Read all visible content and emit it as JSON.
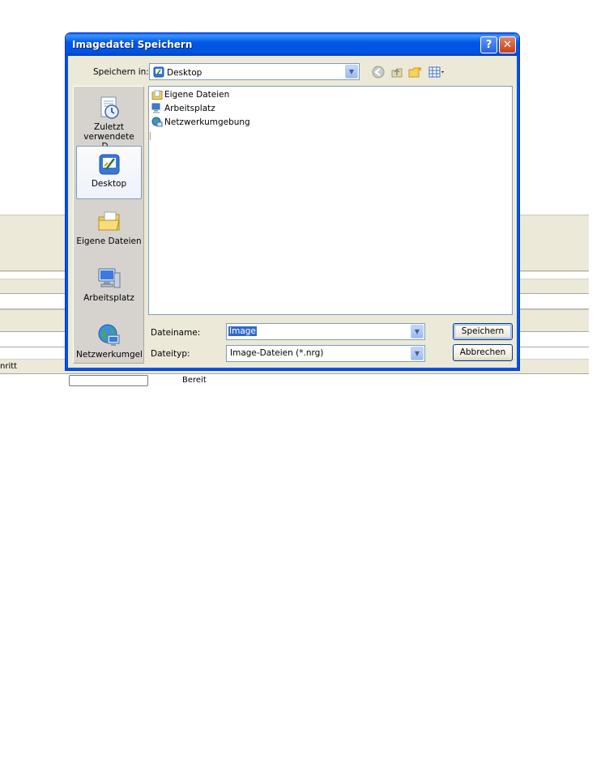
{
  "background": {
    "status_partial": "nritt",
    "status_ready": "Bereit"
  },
  "dialog": {
    "title": "Imagedatei Speichern",
    "help_glyph": "?",
    "close_glyph": "✕",
    "save_in_label": "Speichern in:",
    "save_in_value": "Desktop",
    "places": [
      {
        "label": "Zuletzt verwendete D...",
        "icon": "recent-icon"
      },
      {
        "label": "Desktop",
        "icon": "desktop-icon"
      },
      {
        "label": "Eigene Dateien",
        "icon": "my-documents-icon"
      },
      {
        "label": "Arbeitsplatz",
        "icon": "my-computer-icon"
      },
      {
        "label": "Netzwerkumgeb",
        "icon": "network-icon"
      }
    ],
    "files": [
      {
        "name": "Eigene Dateien",
        "icon": "my-documents-icon"
      },
      {
        "name": "Arbeitsplatz",
        "icon": "my-computer-icon"
      },
      {
        "name": "Netzwerkumgebung",
        "icon": "network-icon"
      }
    ],
    "filename_label": "Dateiname:",
    "filename_value": "Image",
    "filetype_label": "Dateityp:",
    "filetype_value": "Image-Dateien (*.nrg)",
    "save_button": "Speichern",
    "cancel_button": "Abbrechen"
  }
}
